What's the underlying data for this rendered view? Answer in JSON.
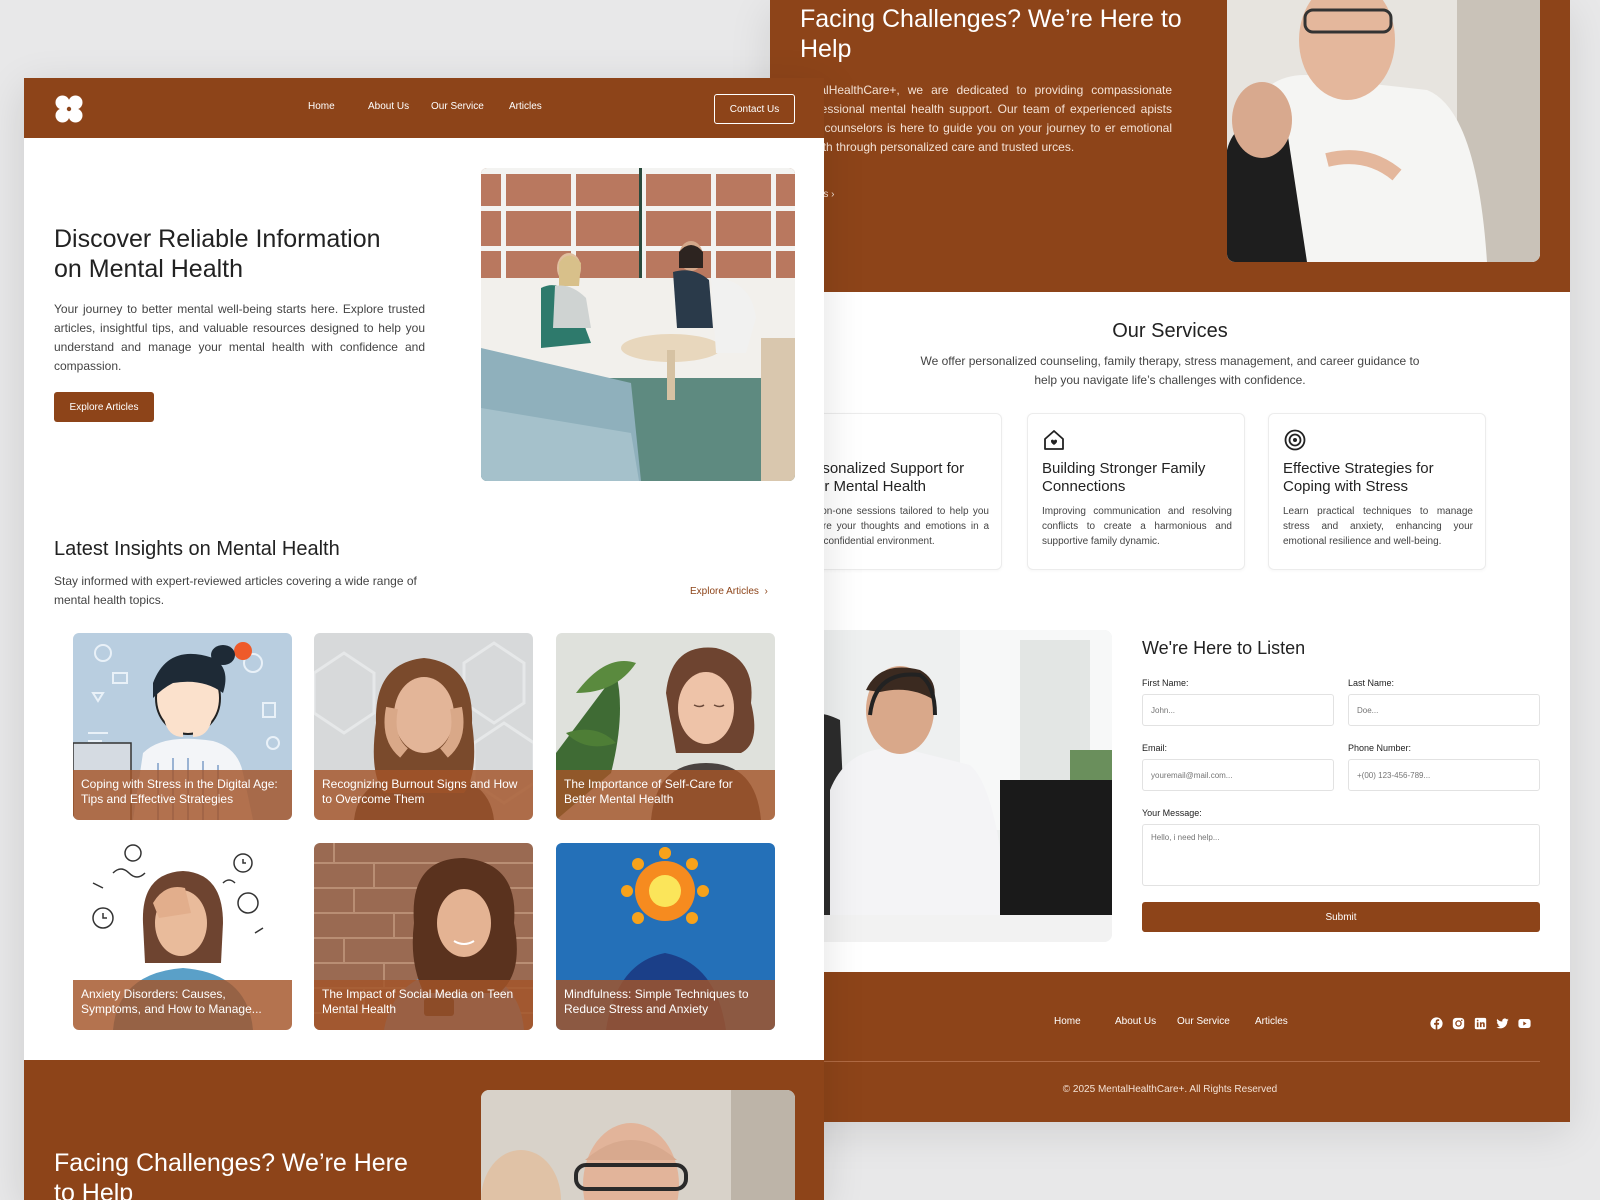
{
  "brand": {
    "accent": "#8d4419",
    "copyright": "© 2025 MentalHealthCare+. All Rights Reserved"
  },
  "nav": {
    "items": [
      "Home",
      "About Us",
      "Our Service",
      "Articles"
    ],
    "contact": "Contact Us"
  },
  "hero": {
    "title": "Discover Reliable Information on Mental Health",
    "body": "Your journey to better mental well-being starts here. Explore trusted articles, insightful tips, and valuable resources designed to help you understand and manage your mental health with confidence and compassion.",
    "button": "Explore Articles"
  },
  "insights": {
    "title": "Latest Insights on Mental Health",
    "subtitle": "Stay informed with expert-reviewed articles covering a wide range of mental health topics.",
    "link": "Explore Articles",
    "articles": [
      {
        "title": "Coping with Stress in the Digital Age: Tips and Effective Strategies"
      },
      {
        "title": "Recognizing Burnout Signs and How to Overcome Them"
      },
      {
        "title": "The Importance of Self-Care for Better Mental Health"
      },
      {
        "title": "Anxiety Disorders: Causes, Symptoms, and How to Manage..."
      },
      {
        "title": "The Impact of Social Media on Teen Mental Health"
      },
      {
        "title": "Mindfulness: Simple Techniques to Reduce Stress and Anxiety"
      }
    ]
  },
  "cta": {
    "title": "Facing Challenges? We’re Here to Help",
    "body_visible": "lentalHealthCare+, we are dedicated to providing compassionate professional mental health support. Our team of experienced apists and counselors is here to guide you on your journey to er emotional health through personalized care and trusted urces.",
    "link_visible": "act Us"
  },
  "services": {
    "title": "Our Services",
    "subtitle": "We offer personalized counseling, family therapy, stress management, and career guidance to help you navigate life’s challenges with confidence.",
    "items": [
      {
        "icon": "hand-heart-icon",
        "title": "Personalized Support for Your Mental Health",
        "body": "One-on-one sessions tailored to help you explore your thoughts and emotions in a safe, confidential environment."
      },
      {
        "icon": "home-heart-icon",
        "title": "Building Stronger Family Connections",
        "body": "Improving communication and resolving conflicts to create a harmonious and supportive family dynamic."
      },
      {
        "icon": "target-icon",
        "title": "Effective Strategies for Coping with Stress",
        "body": "Learn practical techniques to manage stress and anxiety, enhancing your emotional resilience and well-being."
      }
    ]
  },
  "contact": {
    "title": "We're Here to Listen",
    "first_name_label": "First Name:",
    "first_name_placeholder": "John...",
    "last_name_label": "Last Name:",
    "last_name_placeholder": "Doe...",
    "email_label": "Email:",
    "email_placeholder": "youremail@mail.com...",
    "phone_label": "Phone Number:",
    "phone_placeholder": "+(00) 123-456-789...",
    "message_label": "Your Message:",
    "message_placeholder": "Hello, i need help...",
    "submit": "Submit"
  },
  "footer": {
    "nav": [
      "Home",
      "About Us",
      "Our Service",
      "Articles"
    ],
    "social": [
      "facebook-icon",
      "instagram-icon",
      "linkedin-icon",
      "twitter-icon",
      "youtube-icon"
    ]
  }
}
